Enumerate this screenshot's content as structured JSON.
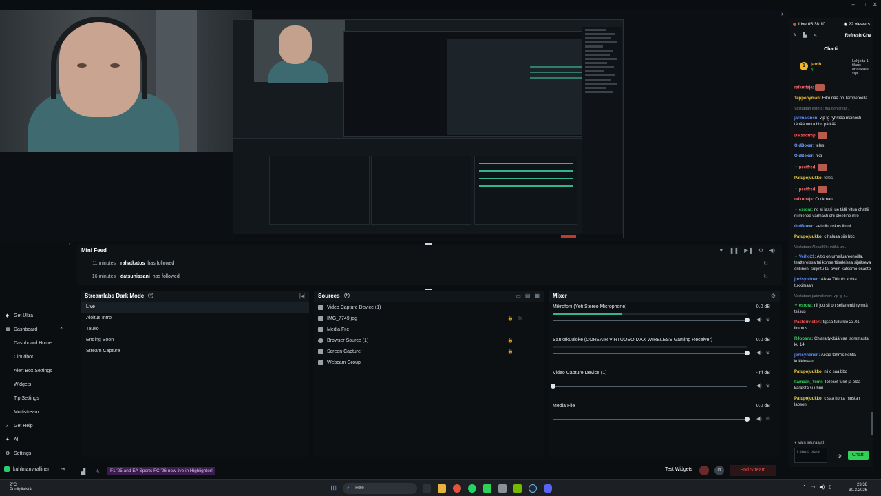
{
  "chat": {
    "live_label": "Live",
    "live_time": "05:38:10",
    "viewers": "22 viewers",
    "refresh_label": "Refresh Chat",
    "title": "Chatti",
    "gift_user": "jamb...",
    "gift_count": "4",
    "gift_text": "Lahjoita 1 tilaus ottaaksesi 2. sija",
    "followers_only": "Vain seuraajat",
    "input_placeholder": "Lähetä viesti",
    "send_label": "Chatti",
    "messages": [
      {
        "user": "raikuttaja:",
        "color": "#ff6b6b",
        "text": "",
        "emote": true
      },
      {
        "user": "Tepponyman:",
        "color": "#f0b828",
        "text": "Eikö nää oo Tampereella"
      },
      {
        "user": "",
        "color": "#7d8891",
        "reply": "Vastataan esrora: mä oon chiar...",
        "text": ""
      },
      {
        "user": "jarimakinen:",
        "color": "#5b8cff",
        "text": "vip tg ryhmää mainosti tänää uutta bbc pätkää"
      },
      {
        "user": "Dikaadtmp:",
        "color": "#ff5555",
        "text": "",
        "emote": true
      },
      {
        "user": "OldBoxer:",
        "color": "#6fa0ff",
        "text": "teles"
      },
      {
        "user": "OldBoxer:",
        "color": "#6fa0ff",
        "text": "hkä"
      },
      {
        "user": "peetfred:",
        "color": "#ff6b6b",
        "text": "",
        "emote": true
      },
      {
        "user": "Patupojuukko:",
        "color": "#f0d448",
        "text": "teles"
      },
      {
        "user": "peetfred:",
        "color": "#ff6b6b",
        "text": "",
        "emote": true
      },
      {
        "user": "raikuttaja:",
        "color": "#ff6b6b",
        "text": "Cuckman"
      },
      {
        "user": "esrora:",
        "color": "#31d158",
        "text": "no ei lassi lue tätä vitun chattii ni menee varmasti ohi oleelline info"
      },
      {
        "user": "OldBoxer:",
        "color": "#6fa0ff",
        "text": "siel ollu oskus ilmoi"
      },
      {
        "user": "Patupojuukko:",
        "color": "#f0d448",
        "text": "c haluaa siis bbc"
      },
      {
        "user": "",
        "color": "#7d8891",
        "reply": "Vastataan Alexa89h: mitkä un...",
        "text": ""
      },
      {
        "user": "Veiho21:",
        "color": "#5b8cff",
        "text": "Aitio on urheiluareenoilla, teattereissa tai konserttisaleissa sijaitseva erillinen, suljettu tai avoin katsomo-osasto"
      },
      {
        "user": "jonisyntinen:",
        "color": "#5b8cff",
        "text": "Aikaa Töhn'is kohta tukkimaan"
      },
      {
        "user": "",
        "color": "#7d8891",
        "reply": "Vastataan jarimakinen: vip tg r...",
        "text": ""
      },
      {
        "user": "esrora:",
        "color": "#31d158",
        "text": "nii joo sil on sellanenki ryhmä tsiisus"
      },
      {
        "user": "Pastorivisteri:",
        "color": "#ff5555",
        "text": "tgssä tullu klo 23.01 ilmotus"
      },
      {
        "user": "R4ppana:",
        "color": "#31d158",
        "text": "Chiara tykkää vaa isommasta ku 14"
      },
      {
        "user": "jonisyntinen:",
        "color": "#5b8cff",
        "text": "Aikaa töhn'is kohta kukkimaan"
      },
      {
        "user": "Patupojuukko:",
        "color": "#f0d448",
        "text": "nii c saa bbc"
      },
      {
        "user": "Itamaan_Tomi:",
        "color": "#31d158",
        "text": "Tolleset tulot ja elää kädestä suuhun.."
      },
      {
        "user": "Patupojuukko:",
        "color": "#f0d448",
        "text": "c saa kohta mustan lapsen"
      }
    ]
  },
  "minifeed": {
    "title": "Mini Feed",
    "rows": [
      {
        "time": "11 minutes",
        "user": "rahatkatos",
        "action": "has followed"
      },
      {
        "time": "16 minutes",
        "user": "datsunissani",
        "action": "has followed"
      }
    ]
  },
  "scenes": {
    "title": "Streamlabs Dark Mode",
    "items": [
      "Live",
      "Aloitus Intro",
      "Tauko",
      "Ending Soon",
      "Stream Capture"
    ]
  },
  "sources": {
    "title": "Sources",
    "items": [
      "Video Capture Device (1)",
      "IMG_7749.jpg",
      "Media File",
      "Browser Source (1)",
      "Screen Capture",
      "Webcam Group"
    ]
  },
  "mixer": {
    "title": "Mixer",
    "channels": [
      {
        "name": "Mikrofoni (Yeti Stereo Microphone)",
        "db": "0.0 dB",
        "level": 0.35,
        "volume": 1.0
      },
      {
        "name": "Sankakuuloke (CORSAIR VIRTUOSO MAX WIRELESS Gaming Receiver)",
        "db": "0.0 dB",
        "level": 0.0,
        "volume": 1.0
      },
      {
        "name": "Video Capture Device (1)",
        "db": "-Inf dB",
        "level": 0.0,
        "volume": 0.0
      },
      {
        "name": "Media File",
        "db": "0.0 dB",
        "level": 0.0,
        "volume": 1.0
      }
    ]
  },
  "nav": {
    "items": [
      {
        "label": "Get Ultra",
        "sub": false
      },
      {
        "label": "Dashboard",
        "sub": false
      },
      {
        "label": "Dashboard Home",
        "sub": true
      },
      {
        "label": "Cloudbot",
        "sub": true
      },
      {
        "label": "Alert Box Settings",
        "sub": true
      },
      {
        "label": "Widgets",
        "sub": true
      },
      {
        "label": "Tip Settings",
        "sub": true
      },
      {
        "label": "Multistream",
        "sub": true
      },
      {
        "label": "Get Help",
        "sub": false
      },
      {
        "label": "AI",
        "sub": false
      },
      {
        "label": "Settings",
        "sub": false
      }
    ],
    "username": "kuhlmanvirallinen"
  },
  "bottombar": {
    "news": "F1 '25 and EA Sports FC '26 now live in Highlighter!",
    "test_widgets": "Test Widgets",
    "end_stream": "End Stream"
  },
  "taskbar": {
    "weather_temp": "2°C",
    "weather_desc": "Puolipilvistä",
    "search": "Hae",
    "time": "23.38",
    "date": "30.3.2026"
  },
  "colors": {
    "accent": "#31d158",
    "meter": "#31b58f",
    "end_stream": "#f24e4e"
  }
}
